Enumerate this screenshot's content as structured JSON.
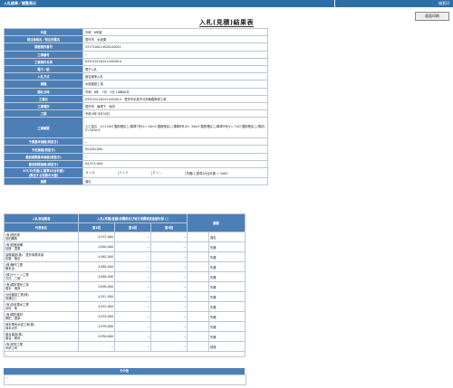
{
  "topbar": {
    "left": "入札結果／閲覧表示",
    "right": "検索印"
  },
  "print_button": "画面印刷",
  "title": "入札(見積)結果表",
  "info": [
    {
      "label": "年度",
      "value": "令和　6年度"
    },
    {
      "label": "発注部局名／発注所属名",
      "value": "豊作市　水道課"
    },
    {
      "label": "調達案件番号",
      "value": "3317100114S20240021"
    },
    {
      "label": "工事番号",
      "value": "--"
    },
    {
      "label": "工事案件名称",
      "value": "K332101202411450014"
    },
    {
      "label": "電子／紙",
      "value": "電子入札"
    },
    {
      "label": "入札方式",
      "value": "指名競争入札"
    },
    {
      "label": "業種",
      "value": "水道施設工事"
    },
    {
      "label": "開札日時",
      "value": "令和　6年　7月　3日 10時00分"
    },
    {
      "label": "工事名",
      "value": "K332101202411450014　豊作市水道不分割管路等修工事"
    },
    {
      "label": "工事場所",
      "value": "豊作市　篠塚下　地内"
    },
    {
      "label": "工期",
      "value": "令和 6年 9月30日"
    },
    {
      "label": "工事概要",
      "value": "土工量注　V=13m3 掘削埋戻し(車庫7号)V= 34m3 掘削埋戻し(車庫8号)V= 34m3 掘削埋戻し(車庫5号)V= 7m3 掘削埋戻し(現状)　V=102m3"
    },
    {
      "label": "予算基本価格(税抜き)",
      "value": "--"
    },
    {
      "label": "予定価格(税抜き)",
      "value": "¥5,000,000-"
    },
    {
      "label": "最低制限基本価格(税抜き)",
      "value": "--"
    },
    {
      "label": "最低制限価格(税抜き)",
      "value": "¥4,972,000-"
    },
    {
      "label": "X/Y/Z(失格(に基準)の合計値)",
      "label2": "(算出する試算の大値)",
      "x": "X = 0",
      "y": "Y = 2",
      "z": "Z = --",
      "extra": "失格(に基準)の合計値 = 5402"
    },
    {
      "label": "摘要",
      "value": "落札"
    }
  ],
  "bids_header": {
    "group": "入札参加業者",
    "name_col": "代表者名",
    "price_group": "入札(見積)金額(消費税及び地方消費税抜金額を除く)",
    "round1": "第1回",
    "round2": "第2回",
    "round3": "第3回",
    "remarks": "摘要"
  },
  "bidders": [
    {
      "name1": "(有)田田得",
      "name2": "田田勝衛",
      "r1": "4,972,000",
      "r2": "--",
      "r3": "--",
      "remark": "落札"
    },
    {
      "name1": "(有)桂慢設備",
      "name2": "桂慢　豊泰",
      "r1": "4,840,000",
      "r2": "--",
      "r3": "--",
      "remark": "失格"
    },
    {
      "name1": "高陽建設(株)　豊作事業本部",
      "name2": "佐藤　隆志",
      "r1": "4,962,000",
      "r2": "--",
      "r3": "--",
      "remark": "失格"
    },
    {
      "name1": "(株)権作工業",
      "name2": "権本治",
      "r1": "4,884,000",
      "r2": "--",
      "r3": "--",
      "remark": "失格"
    },
    {
      "name1": "(株)サイトン工業",
      "name2": "古庄　三郎",
      "r1": "4,884,000",
      "r2": "--",
      "r3": "--",
      "remark": "失格"
    },
    {
      "name1": "(有)堀本電気工事",
      "name2": "堀本　明良",
      "r1": "4,890,000",
      "r2": "--",
      "r3": "--",
      "remark": "失格"
    },
    {
      "name1": "大信建設工業(株)",
      "name2": "常通正と",
      "r1": "4,911,000",
      "r2": "--",
      "r3": "--",
      "remark": "失格"
    },
    {
      "name1": "(有)京信電水工業",
      "name2": "京信　祐",
      "r1": "4,922,000",
      "r2": "--",
      "r3": "--",
      "remark": "失格"
    },
    {
      "name1": "(有)桐田建材",
      "name2": "桐田　廣幸",
      "r1": "4,933,000",
      "r2": "--",
      "r3": "--",
      "remark": "失格"
    },
    {
      "name1": "岡本電気水道工事(株)",
      "name2": "岡本大作",
      "r1": "4,939,000",
      "r2": "--",
      "r3": "--",
      "remark": "失格"
    },
    {
      "name1": "唐谷建設(株)",
      "name2": "唐谷　耕司",
      "r1": "4,950,000",
      "r2": "--",
      "r3": "--",
      "remark": "失格"
    },
    {
      "name1": "(有)宏知工業",
      "name2": "市伊上司",
      "r1": "--",
      "r2": "--",
      "r3": "--",
      "remark": "辞退"
    }
  ],
  "bids_footer": "--",
  "other": {
    "header": "その他",
    "value": "--"
  }
}
